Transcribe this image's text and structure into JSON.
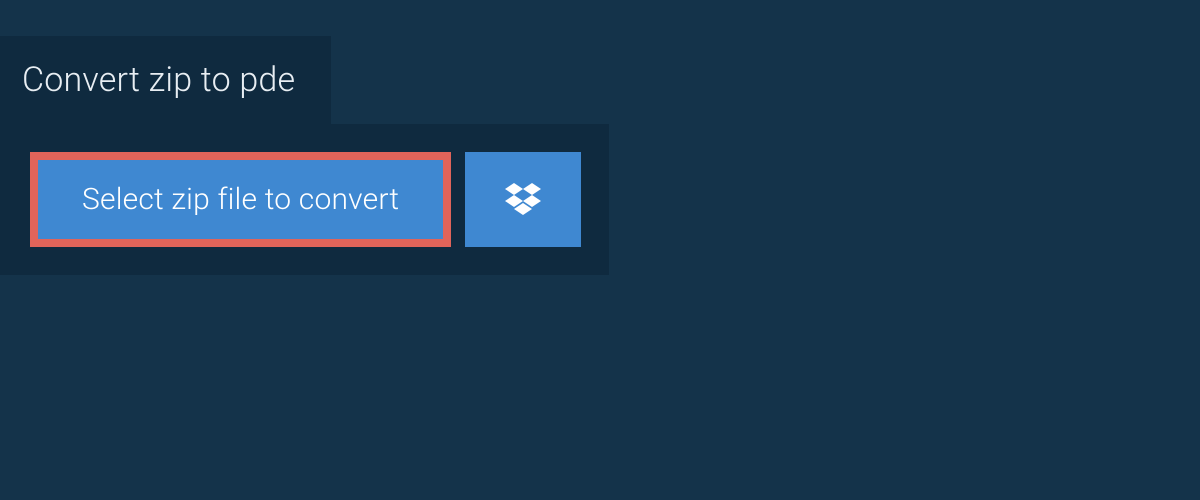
{
  "header": {
    "title": "Convert zip to pde"
  },
  "actions": {
    "select_label": "Select zip file to convert"
  },
  "colors": {
    "page_bg": "#14334a",
    "panel_bg": "#0f2a3f",
    "button_bg": "#3f88d1",
    "highlight_border": "#e0645a",
    "text_light": "#e8eef3"
  }
}
